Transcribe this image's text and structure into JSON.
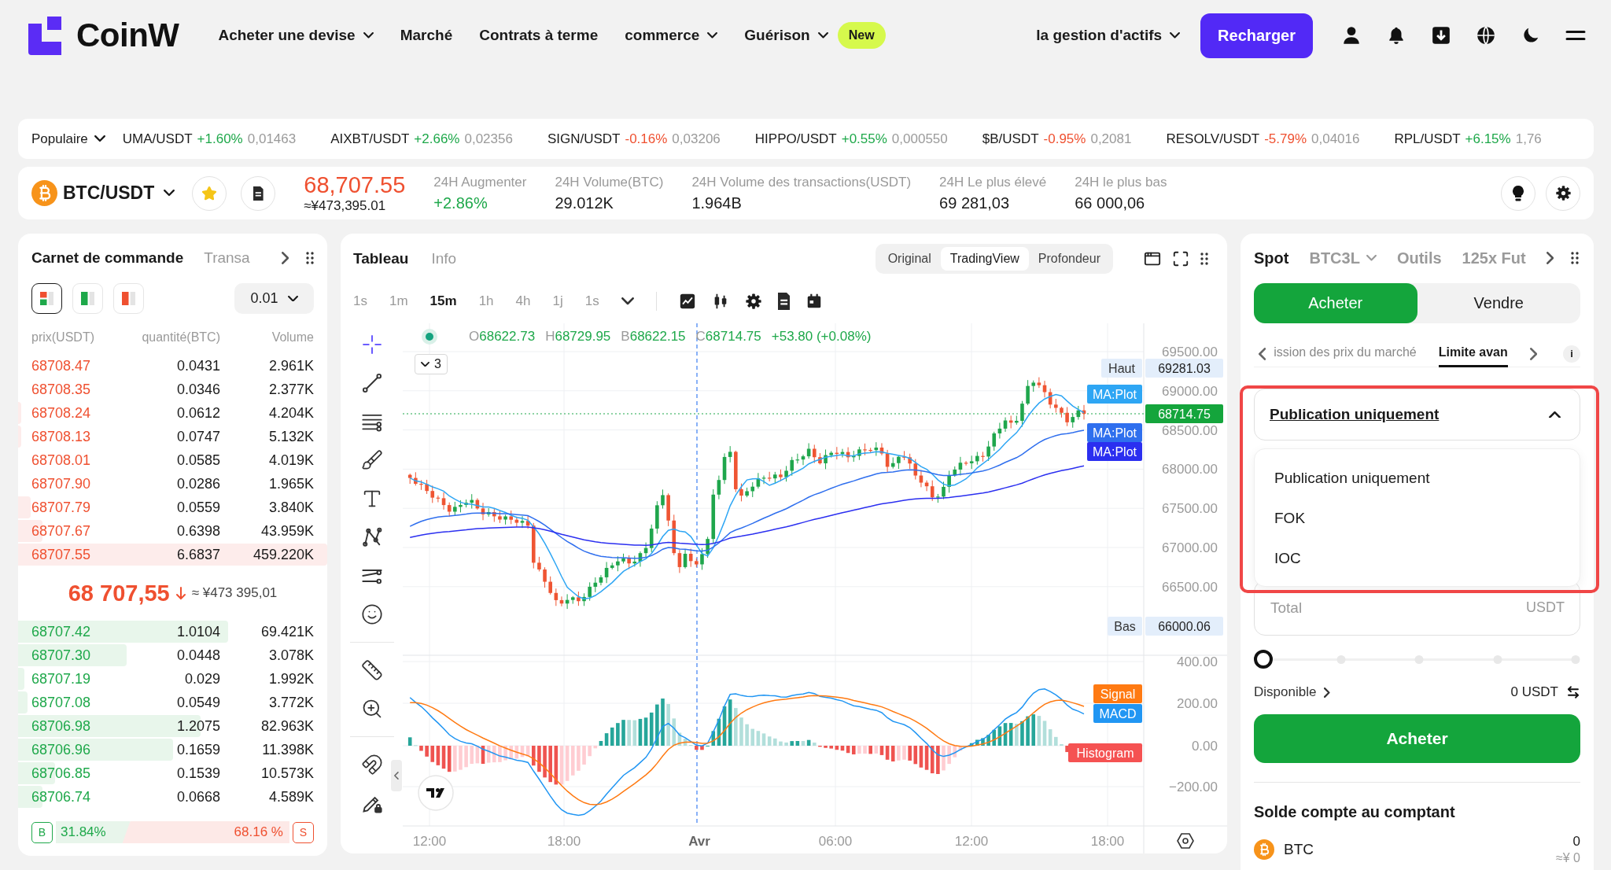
{
  "nav": {
    "logo": "CoinW",
    "items": [
      {
        "label": "Acheter une devise",
        "dropdown": true
      },
      {
        "label": "Marché",
        "dropdown": false
      },
      {
        "label": "Contrats à terme",
        "dropdown": false
      },
      {
        "label": "commerce",
        "dropdown": true
      },
      {
        "label": "Guérison",
        "dropdown": true,
        "badge": "New"
      }
    ],
    "assets_menu": {
      "label": "la gestion d'actifs",
      "dropdown": true
    },
    "deposit_button": "Recharger"
  },
  "ticker": {
    "filter": "Populaire",
    "items": [
      {
        "pair": "UMA/USDT",
        "change": "+1.60%",
        "price": "0,01463",
        "up": true
      },
      {
        "pair": "AIXBT/USDT",
        "change": "+2.66%",
        "price": "0,02356",
        "up": true
      },
      {
        "pair": "SIGN/USDT",
        "change": "-0.16%",
        "price": "0,03206",
        "up": false
      },
      {
        "pair": "HIPPO/USDT",
        "change": "+0.55%",
        "price": "0,000550",
        "up": true
      },
      {
        "pair": "$B/USDT",
        "change": "-0.95%",
        "price": "0,2081",
        "up": false
      },
      {
        "pair": "RESOLV/USDT",
        "change": "-5.79%",
        "price": "0,04016",
        "up": false
      },
      {
        "pair": "RPL/USDT",
        "change": "+6.15%",
        "price": "1,76",
        "up": true
      }
    ]
  },
  "pair_bar": {
    "pair": "BTC/USDT",
    "favorite": true,
    "price": "68,707.55",
    "up": false,
    "price_cny": "≈¥473,395.01",
    "stats": [
      {
        "label": "24H Augmenter",
        "value": "+2.86%",
        "kind": "gain"
      },
      {
        "label": "24H Volume(BTC)",
        "value": "29.012K",
        "kind": "plain"
      },
      {
        "label": "24H Volume des transactions(USDT)",
        "value": "1.964B",
        "kind": "plain"
      },
      {
        "label": "24H Le plus élevé",
        "value": "69 281,03",
        "kind": "plain"
      },
      {
        "label": "24H le plus bas",
        "value": "66 000,06",
        "kind": "plain"
      }
    ]
  },
  "order_book": {
    "title": "Carnet de commande",
    "next_tab": "Transa",
    "views": [
      {
        "kind": "both",
        "selected": true
      },
      {
        "kind": "bids",
        "selected": false
      },
      {
        "kind": "asks",
        "selected": false
      }
    ],
    "precision": "0.01",
    "columns": [
      "prix(USDT)",
      "quantité(BTC)",
      "Volume"
    ],
    "asks": [
      {
        "price": "68708.47",
        "qty": "0.0431",
        "volume": "2.961K"
      },
      {
        "price": "68708.35",
        "qty": "0.0346",
        "volume": "2.377K"
      },
      {
        "price": "68708.24",
        "qty": "0.0612",
        "volume": "4.204K",
        "level": 0.01
      },
      {
        "price": "68708.13",
        "qty": "0.0747",
        "volume": "5.132K",
        "level": 0.01
      },
      {
        "price": "68708.01",
        "qty": "0.0585",
        "volume": "4.019K"
      },
      {
        "price": "68707.90",
        "qty": "0.0286",
        "volume": "1.965K"
      },
      {
        "price": "68707.79",
        "qty": "0.0559",
        "volume": "3.840K",
        "level": 0.04
      },
      {
        "price": "68707.67",
        "qty": "0.6398",
        "volume": "43.959K",
        "level": 0.08
      },
      {
        "price": "68707.55",
        "qty": "6.6837",
        "volume": "459.220K",
        "level": 1
      }
    ],
    "last": {
      "price": "68 707,55",
      "cny": "≈ ¥473 395,01",
      "up": false
    },
    "bids": [
      {
        "price": "68707.42",
        "qty": "1.0104",
        "volume": "69.421K",
        "level": 0.68
      },
      {
        "price": "68707.30",
        "qty": "0.0448",
        "volume": "3.078K",
        "level": 0.35
      },
      {
        "price": "68707.19",
        "qty": "0.029",
        "volume": "1.992K",
        "level": 0.02
      },
      {
        "price": "68707.08",
        "qty": "0.0549",
        "volume": "3.772K",
        "level": 0.03
      },
      {
        "price": "68706.98",
        "qty": "1.2075",
        "volume": "82.963K",
        "level": 0.59
      },
      {
        "price": "68706.96",
        "qty": "0.1659",
        "volume": "11.398K",
        "level": 0.5
      },
      {
        "price": "68706.85",
        "qty": "0.1539",
        "volume": "10.573K",
        "level": 0.12
      },
      {
        "price": "68706.74",
        "qty": "0.0668",
        "volume": "4.589K",
        "level": 0.08
      }
    ],
    "ratio": {
      "buy_tag": "B",
      "buy": "31.84%",
      "sell": "68.16 %",
      "sell_tag": "S",
      "level": 0.3184
    }
  },
  "chart": {
    "tabs": [
      {
        "label": "Tableau",
        "selected": true
      },
      {
        "label": "Info",
        "selected": false
      }
    ],
    "views": [
      {
        "label": "Original",
        "selected": false
      },
      {
        "label": "TradingView",
        "selected": true
      },
      {
        "label": "Profondeur",
        "selected": false
      }
    ],
    "intervals": [
      {
        "label": "1s",
        "selected": false
      },
      {
        "label": "1m",
        "selected": false
      },
      {
        "label": "15m",
        "selected": true
      },
      {
        "label": "1h",
        "selected": false
      },
      {
        "label": "4h",
        "selected": false
      },
      {
        "label": "1j",
        "selected": false
      },
      {
        "label": "1s",
        "selected": false
      }
    ],
    "legend": {
      "fields": [
        {
          "key": "O",
          "value": "68622.73"
        },
        {
          "key": "H",
          "value": "68729.95"
        },
        {
          "key": "B",
          "value": "68622.15"
        },
        {
          "key": "C",
          "value": "68714.75"
        }
      ],
      "change": "+53.80 (+0.08%)"
    },
    "indicators": "3",
    "price_axis": [
      "69500.00",
      "69000.00",
      "68500.00",
      "68000.00",
      "67500.00",
      "67000.00",
      "66500.00"
    ],
    "high": {
      "label": "Haut",
      "value": "69281.03"
    },
    "low": {
      "label": "Bas",
      "value": "66000.06"
    },
    "last_price": "68714.75",
    "ma_tags": [
      {
        "label": "MA:Plot",
        "color": "#2ea6f4"
      },
      {
        "label": "MA:Plot",
        "color": "#2f6fee"
      },
      {
        "label": "MA:Plot",
        "color": "#2b2ff0"
      }
    ],
    "macd_axis": [
      "400.00",
      "200.00",
      "0.00",
      "−200.00"
    ],
    "macd_tags": [
      {
        "label": "Signal",
        "color": "#ff7a12"
      },
      {
        "label": "MACD",
        "color": "#2196f3"
      },
      {
        "label": "Histogram",
        "color": "#f55252"
      }
    ],
    "time_axis": [
      {
        "label": "12:00",
        "kind": "time"
      },
      {
        "label": "18:00",
        "kind": "time"
      },
      {
        "label": "Avr",
        "kind": "day"
      },
      {
        "label": "06:00",
        "kind": "time"
      },
      {
        "label": "12:00",
        "kind": "time"
      },
      {
        "label": "18:00",
        "kind": "time"
      }
    ]
  },
  "trade": {
    "tabs": [
      {
        "label": "Spot",
        "selected": true,
        "dropdown": false
      },
      {
        "label": "BTC3L",
        "selected": false,
        "dropdown": true
      },
      {
        "label": "Outils",
        "selected": false,
        "dropdown": false
      },
      {
        "label": "125x Fut",
        "selected": false,
        "dropdown": false
      }
    ],
    "sides": [
      {
        "label": "Acheter",
        "selected": true
      },
      {
        "label": "Vendre",
        "selected": false
      }
    ],
    "order_types": [
      {
        "label": "ission des prix du marché",
        "selected": false
      },
      {
        "label": "Limite avan",
        "selected": true
      }
    ],
    "info": "i",
    "time_in_force": {
      "value": "Publication uniquement",
      "expanded": true,
      "highlighted": true,
      "options": [
        "Publication uniquement",
        "FOK",
        "IOC"
      ]
    },
    "total": {
      "placeholder": "Total",
      "unit": "USDT"
    },
    "amount_slider": {
      "level": 0
    },
    "available": {
      "label": "Disponible",
      "value": "0 USDT"
    },
    "submit": "Acheter",
    "balance": {
      "title": "Solde compte au comptant",
      "assets": [
        {
          "symbol": "BTC",
          "amount": "0",
          "value": "≈¥ 0"
        }
      ]
    }
  }
}
